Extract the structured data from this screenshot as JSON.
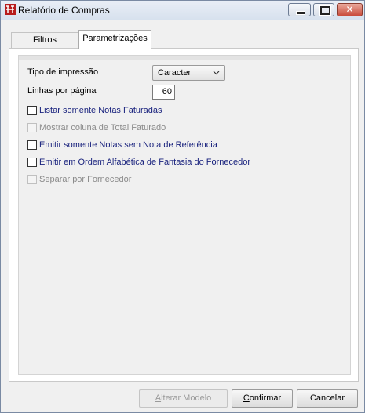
{
  "window": {
    "title": "Relatório de Compras",
    "close_glyph": "✕"
  },
  "tabs": [
    {
      "label": "Filtros",
      "active": false
    },
    {
      "label": "Parametrizações",
      "active": true
    }
  ],
  "form": {
    "print_type_label": "Tipo de impressão",
    "print_type_value": "Caracter",
    "lines_label": "Linhas por página",
    "lines_value": "60"
  },
  "checkboxes": [
    {
      "label": "Listar somente Notas Faturadas",
      "checked": false,
      "enabled": true
    },
    {
      "label": "Mostrar coluna de Total Faturado",
      "checked": false,
      "enabled": false
    },
    {
      "label": "Emitir somente Notas sem Nota de Referência",
      "checked": false,
      "enabled": true
    },
    {
      "label": "Emitir em Ordem Alfabética de Fantasia do Fornecedor",
      "checked": false,
      "enabled": true
    },
    {
      "label": "Separar por Fornecedor",
      "checked": false,
      "enabled": false
    }
  ],
  "buttons": {
    "alterar_first": "A",
    "alterar_rest": "lterar Modelo",
    "confirmar_first": "C",
    "confirmar_rest": "onfirmar",
    "cancelar": "Cancelar"
  }
}
